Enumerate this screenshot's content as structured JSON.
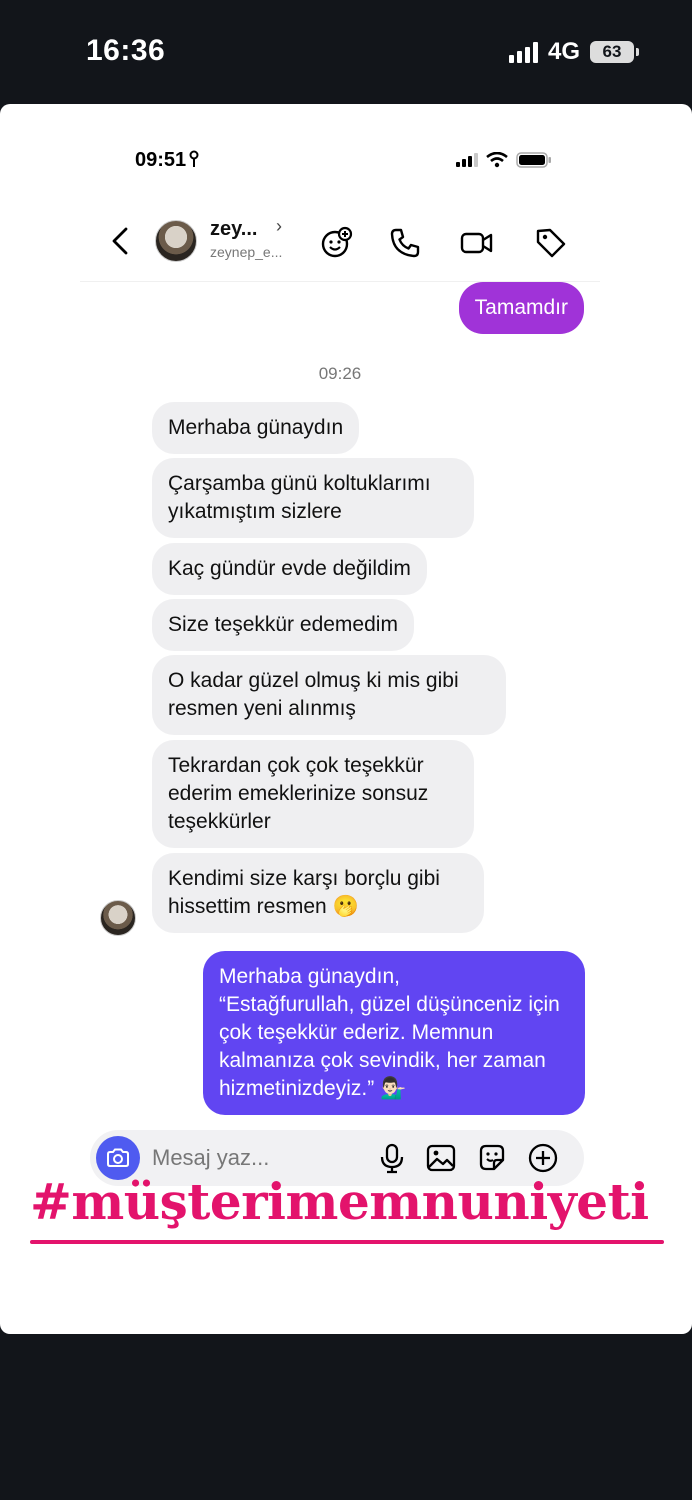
{
  "outer_status": {
    "time": "16:36",
    "network": "4G",
    "battery": "63"
  },
  "inner_status": {
    "time": "09:51"
  },
  "header": {
    "name": "zey...",
    "username": "zeynep_e..."
  },
  "messages": {
    "sent_top": "Tamamdır",
    "timestamp": "09:26",
    "received": [
      "Merhaba günaydın",
      "Çarşamba günü koltuklarımı yıkatmıştım sizlere",
      "Kaç gündür evde değildim",
      "Size teşekkür edemedim",
      "O kadar güzel olmuş ki mis gibi resmen yeni alınmış",
      "Tekrardan çok çok teşekkür ederim emeklerinize sonsuz teşekkürler",
      "Kendimi size karşı borçlu gibi hissettim resmen 🫢"
    ],
    "reply": "Merhaba günaydın,\n“Estağfurullah, güzel düşünceniz için çok teşekkür ederiz. Memnun kalmanıza çok sevindik, her zaman hizmetinizdeyiz.” 💁🏻‍♂️"
  },
  "composer": {
    "placeholder": "Mesaj yaz..."
  },
  "overlay": {
    "hashtag": "#müşterimemnuniyeti"
  },
  "colors": {
    "sent_top": "#a033d8",
    "reply": "#6145f2",
    "hashtag": "#e3136c",
    "camera_button": "#4f5bf0"
  }
}
